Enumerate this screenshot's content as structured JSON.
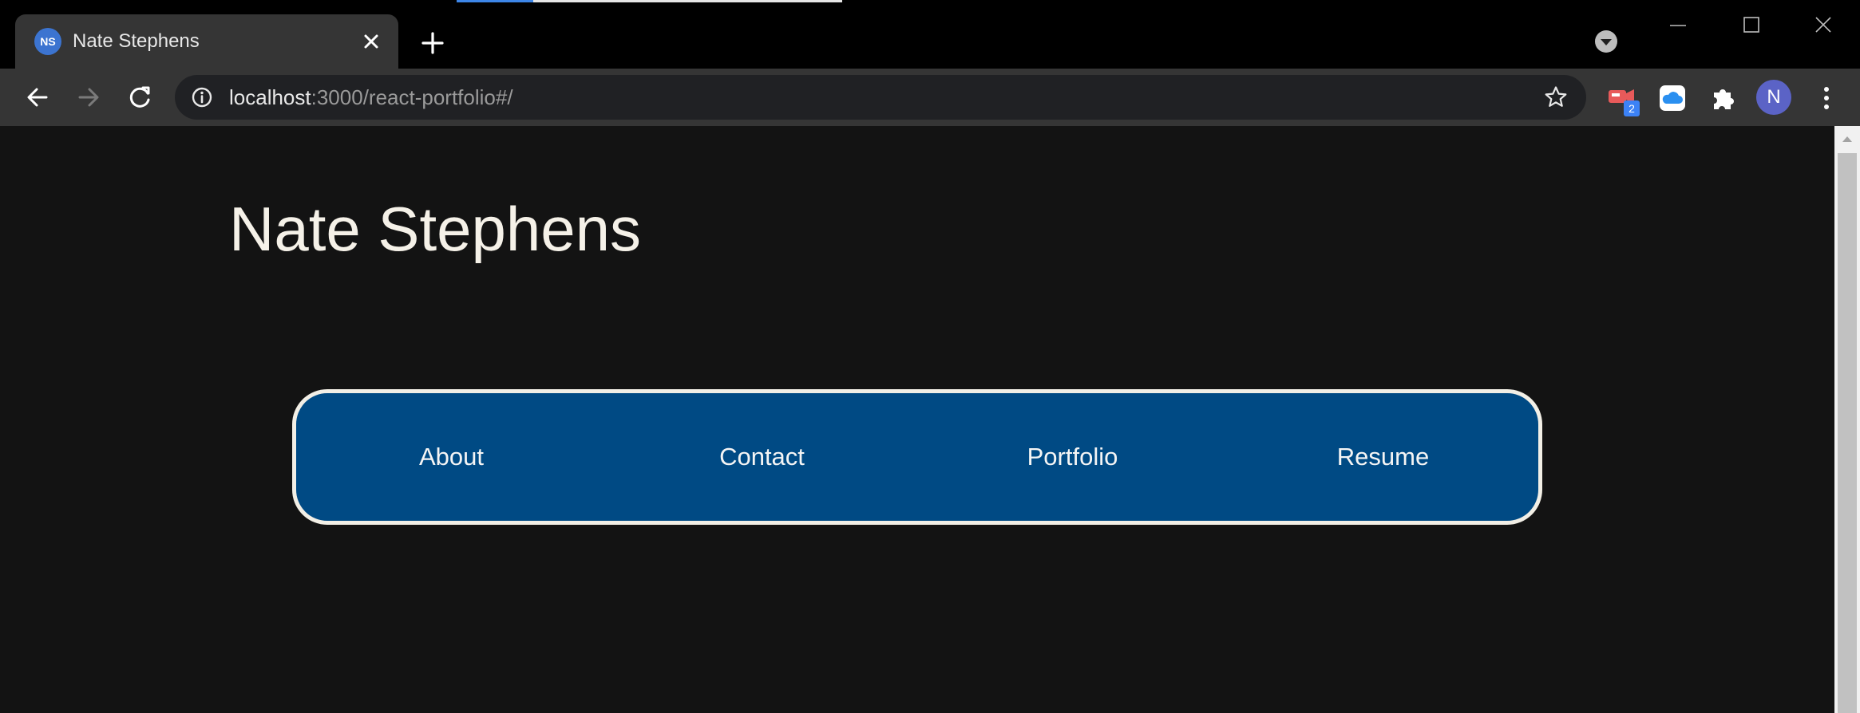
{
  "browser": {
    "tab": {
      "favicon_text": "NS",
      "title": "Nate Stephens"
    },
    "address_bar": {
      "host": "localhost",
      "path": ":3000/react-portfolio#/"
    },
    "extensions": [
      {
        "name": "video-extension-icon",
        "badge": "2"
      },
      {
        "name": "cloud-extension-icon"
      },
      {
        "name": "puzzle-extensions-icon"
      }
    ],
    "profile_initial": "N",
    "colors": {
      "tab_strip": "#000000",
      "toolbar": "#353535",
      "omnibox": "#202124"
    }
  },
  "page": {
    "title": "Nate Stephens",
    "nav": {
      "items": [
        "About",
        "Contact",
        "Portfolio",
        "Resume"
      ]
    },
    "colors": {
      "background": "#131313",
      "nav_background": "#004a84",
      "nav_border": "#f2efe6",
      "text": "#f5f1e8"
    }
  }
}
